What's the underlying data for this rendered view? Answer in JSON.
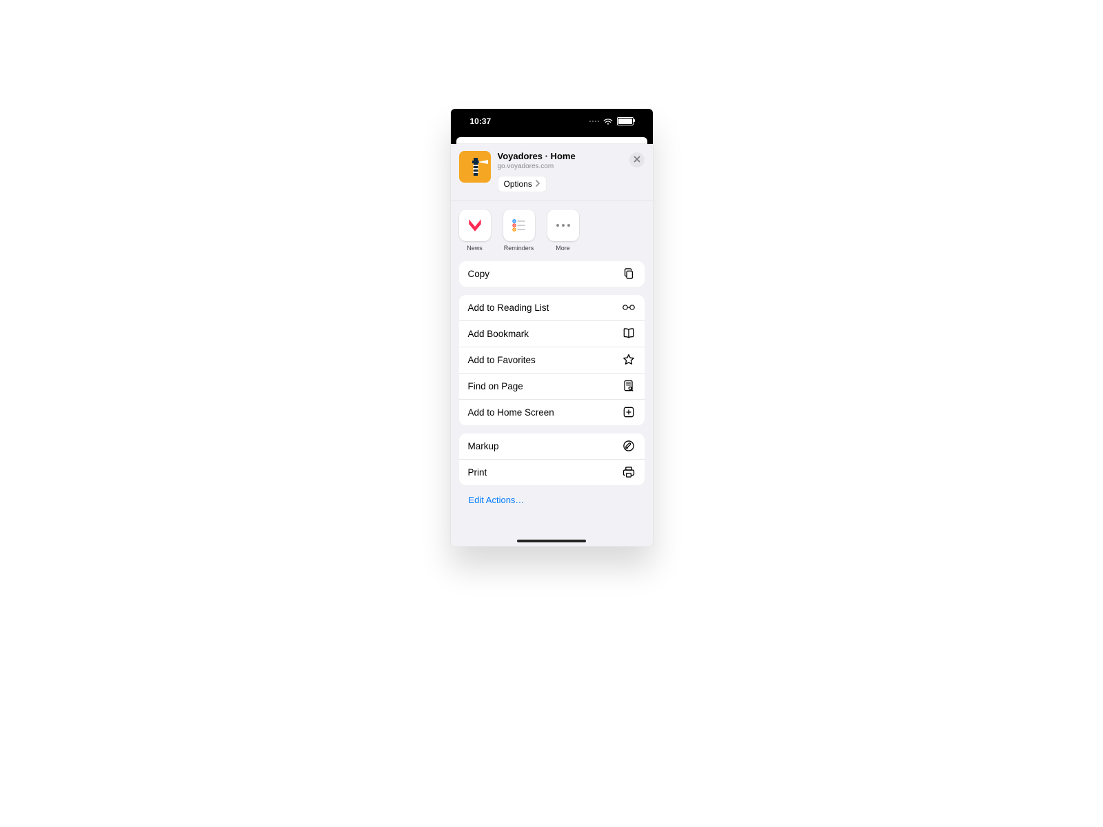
{
  "statusbar": {
    "time": "10:37"
  },
  "header": {
    "title": "Voyadores · Home",
    "url": "go.voyadores.com",
    "options_label": "Options"
  },
  "apps": [
    {
      "id": "news",
      "label": "News"
    },
    {
      "id": "reminders",
      "label": "Reminders"
    },
    {
      "id": "more",
      "label": "More"
    }
  ],
  "groups": [
    {
      "rows": [
        {
          "id": "copy",
          "label": "Copy",
          "icon": "copy"
        }
      ]
    },
    {
      "rows": [
        {
          "id": "reading-list",
          "label": "Add to Reading List",
          "icon": "glasses"
        },
        {
          "id": "bookmark",
          "label": "Add Bookmark",
          "icon": "book"
        },
        {
          "id": "favorites",
          "label": "Add to Favorites",
          "icon": "star"
        },
        {
          "id": "find",
          "label": "Find on Page",
          "icon": "find"
        },
        {
          "id": "homescreen",
          "label": "Add to Home Screen",
          "icon": "plus-square"
        }
      ]
    },
    {
      "rows": [
        {
          "id": "markup",
          "label": "Markup",
          "icon": "markup"
        },
        {
          "id": "print",
          "label": "Print",
          "icon": "print"
        }
      ]
    }
  ],
  "edit_actions_label": "Edit Actions…",
  "colors": {
    "accent": "#007aff",
    "favicon_bg": "#f5a623"
  }
}
